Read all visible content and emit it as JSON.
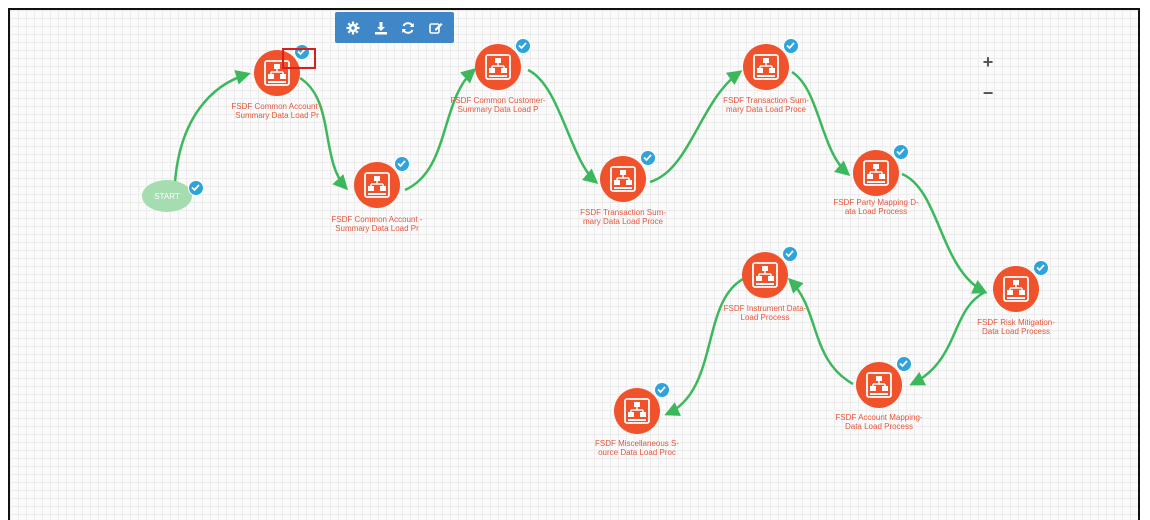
{
  "toolbar": {
    "buttons": [
      {
        "icon": "gear-icon"
      },
      {
        "icon": "download-icon"
      },
      {
        "icon": "refresh-icon"
      },
      {
        "icon": "edit-icon"
      }
    ]
  },
  "zoom": {
    "in_label": "+",
    "out_label": "−"
  },
  "start": {
    "label": "START"
  },
  "colors": {
    "node": "#f0532b",
    "edge": "#3cb85c",
    "check": "#2ea3dc",
    "toolbar": "#3f87c7",
    "highlight": "#d62020",
    "start": "#a5dcb0"
  },
  "nodes": [
    {
      "label": "FSDF Common Account -\nSummary Data Load Pr"
    },
    {
      "label": "FSDF Common Account -\nSummary Data Load Pr"
    },
    {
      "label": "FSDF Common Customer-\nSummary Data Load P"
    },
    {
      "label": "FSDF Transaction Sum-\nmary Data Load Proce"
    },
    {
      "label": "FSDF Transaction Sum-\nmary Data Load Proce"
    },
    {
      "label": "FSDF Party Mapping D-\nata Load Process"
    },
    {
      "label": "FSDF Risk Mitigation-\nData Load Process"
    },
    {
      "label": "FSDF Account Mapping-\nData Load Process"
    },
    {
      "label": "FSDF Instrument Data-\nLoad Process"
    },
    {
      "label": "FSDF Miscellaneous S-\nource Data Load Proc"
    }
  ]
}
